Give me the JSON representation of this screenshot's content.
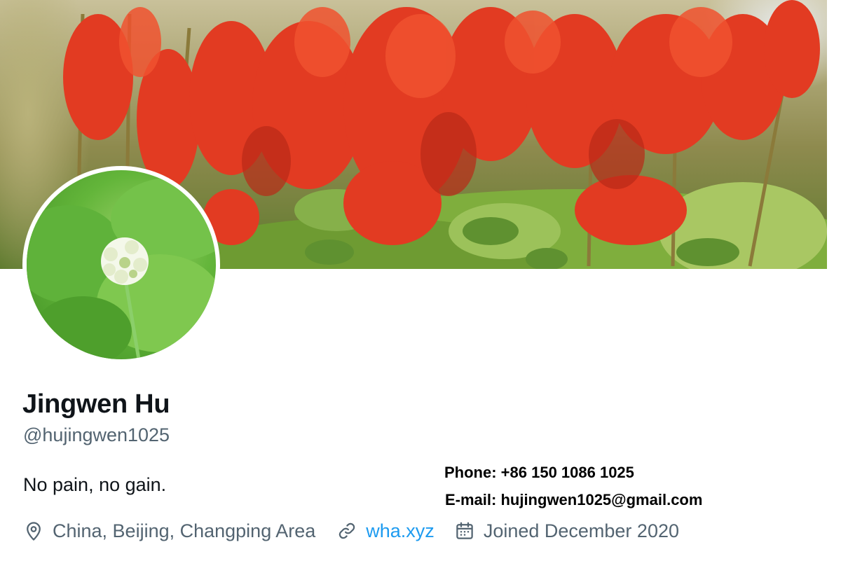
{
  "profile": {
    "display_name": "Jingwen Hu",
    "handle": "@hujingwen1025",
    "bio": "No pain, no gain."
  },
  "contact": {
    "phone": "Phone: +86 150 1086 1025",
    "email": "E-mail: hujingwen1025@gmail.com"
  },
  "meta": {
    "location": "China, Beijing, Changping Area",
    "location_icon": "location-pin-icon",
    "website": "wha.xyz",
    "website_icon": "link-icon",
    "joined": "Joined December 2020",
    "joined_icon": "calendar-icon"
  },
  "colors": {
    "primary_text": "#0f1419",
    "secondary_text": "#536471",
    "link": "#1d9bf0"
  }
}
